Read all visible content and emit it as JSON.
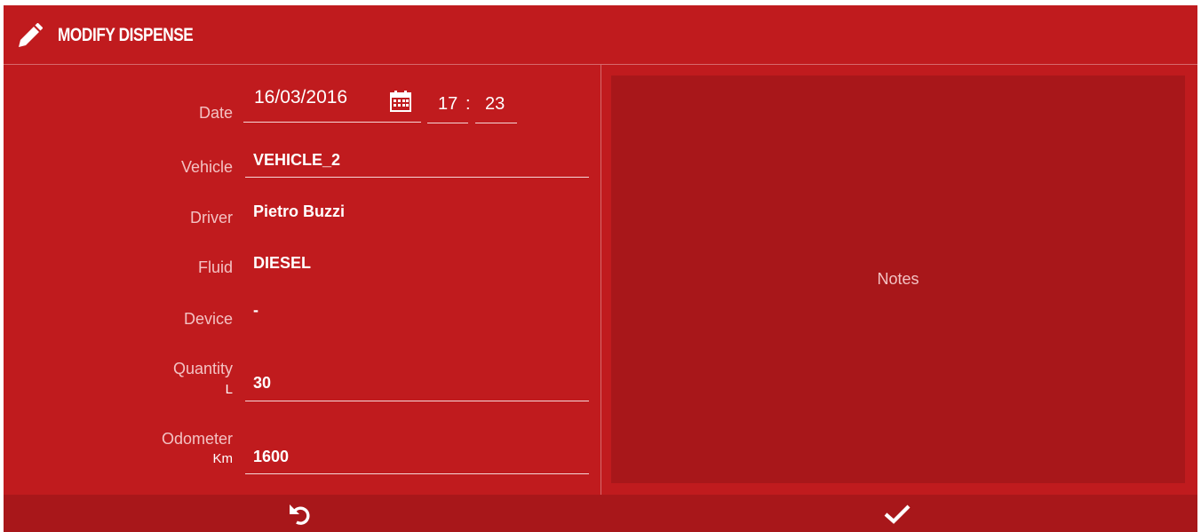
{
  "dialog": {
    "title": "MODIFY DISPENSE",
    "title_icon": "pencil-icon"
  },
  "form": {
    "date_label": "Date",
    "date_value": "16/03/2016",
    "date_icon": "calendar-icon",
    "time_hour": "17",
    "time_separator": ":",
    "time_minute": "23",
    "vehicle_label": "Vehicle",
    "vehicle_value": "VEHICLE_2",
    "driver_label": "Driver",
    "driver_value": "Pietro Buzzi",
    "fluid_label": "Fluid",
    "fluid_value": "DIESEL",
    "device_label": "Device",
    "device_value": "-",
    "quantity_label": "Quantity",
    "quantity_unit": "L",
    "quantity_value": "30",
    "odometer_label": "Odometer",
    "odometer_unit": "Km",
    "odometer_value": "1600"
  },
  "notes": {
    "label": "Notes"
  },
  "footer": {
    "undo_icon": "undo-icon",
    "confirm_icon": "checkmark-icon"
  },
  "colors": {
    "panel": "#c01b1e",
    "dark_panel": "#a8171a",
    "label_text": "#f3c2c3",
    "value_text": "#ffffff"
  }
}
